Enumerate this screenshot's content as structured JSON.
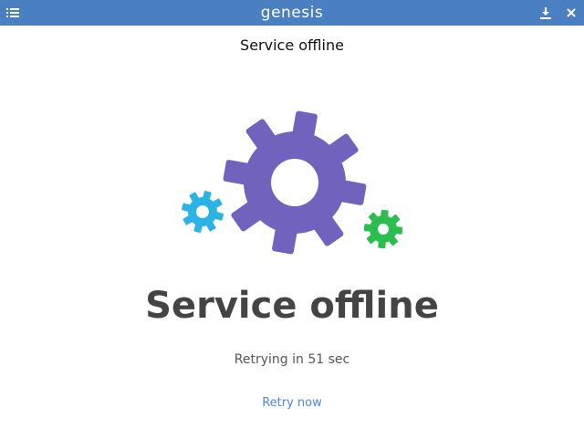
{
  "window": {
    "title": "genesis",
    "icons": {
      "menu": "list-icon",
      "download": "download-icon",
      "close": "close-icon"
    },
    "colors": {
      "titlebar": "#4a7fc1"
    }
  },
  "page": {
    "header_title": "Service offline",
    "headline": "Service offline",
    "retry_status": "Retrying in 51 sec",
    "retry_link": "Retry now"
  },
  "illustration": {
    "icons": [
      "large-gear-icon",
      "small-blue-gear-icon",
      "small-green-gear-icon"
    ],
    "colors": {
      "large_gear": "#7163bd",
      "blue_gear": "#2bb3e6",
      "green_gear": "#2cbd4f"
    }
  }
}
